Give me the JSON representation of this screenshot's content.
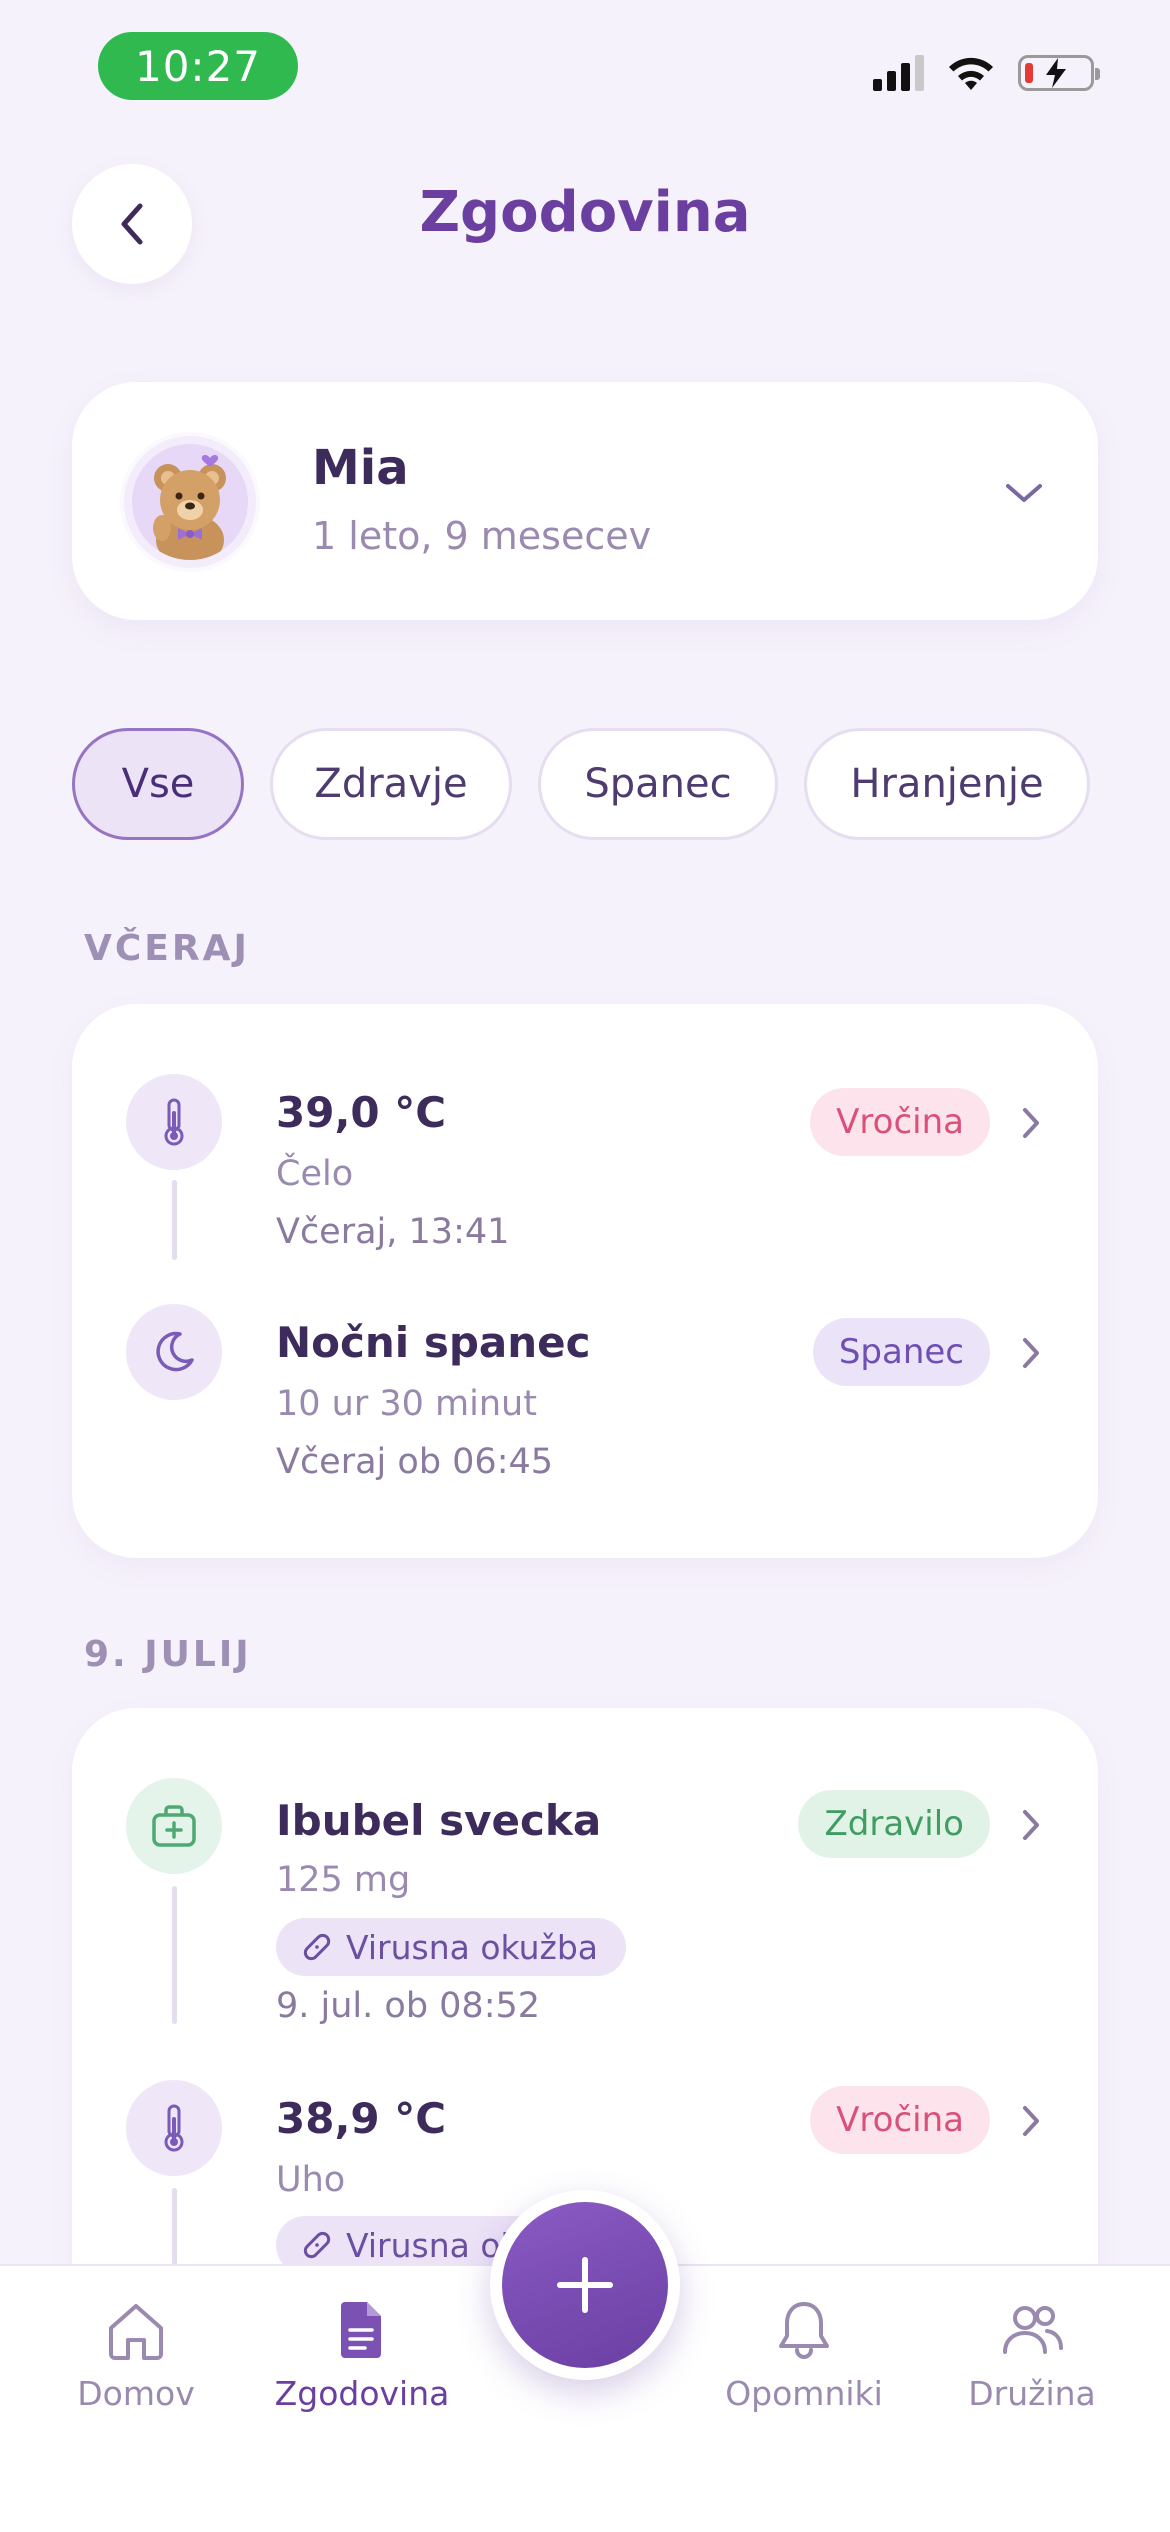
{
  "status_bar": {
    "time": "10:27",
    "battery_level": 0.1,
    "colors": {
      "time_pill": "#2fb94f",
      "battery_low": "#e53935"
    }
  },
  "header": {
    "title": "Zgodovina",
    "back_icon": "chevron-left-icon"
  },
  "child": {
    "name": "Mia",
    "age": "1 leto, 9 mesecev",
    "avatar": "teddy-bear-avatar",
    "selector_icon": "chevron-down-icon"
  },
  "filters": {
    "selected": "Vse",
    "items": [
      {
        "label": "Vse"
      },
      {
        "label": "Zdravje"
      },
      {
        "label": "Spanec"
      },
      {
        "label": "Hranjenje"
      }
    ]
  },
  "sections": [
    {
      "label": "VČERAJ",
      "entries": [
        {
          "icon": "thermometer-icon",
          "title": "39,0 °C",
          "subtitle": "Čelo",
          "time": "Včeraj, 13:41",
          "badge": "Vročina",
          "badge_color": "#d9517a"
        },
        {
          "icon": "moon-icon",
          "title": "Nočni spanec",
          "subtitle": "10 ur 30 minut",
          "time": "Včeraj ob 06:45",
          "badge": "Spanec",
          "badge_color": "#6f4fb5"
        }
      ]
    },
    {
      "label": "9. JULIJ",
      "entries": [
        {
          "icon": "medicine-kit-icon",
          "title": "Ibubel svecka",
          "subtitle": "125 mg",
          "tag": "Virusna okužba",
          "time": "9. jul. ob 08:52",
          "badge": "Zdravilo",
          "badge_color": "#3f9c62"
        },
        {
          "icon": "thermometer-icon",
          "title": "38,9 °C",
          "subtitle": "Uho",
          "tag": "Virusna okužba",
          "badge": "Vročina",
          "badge_color": "#d9517a"
        }
      ]
    }
  ],
  "nav": {
    "items": [
      {
        "label": "Domov",
        "icon": "home-icon"
      },
      {
        "label": "Zgodovina",
        "icon": "document-icon",
        "active": true
      },
      {
        "label": "Opomniki",
        "icon": "bell-icon"
      },
      {
        "label": "Družina",
        "icon": "people-icon"
      }
    ],
    "fab_icon": "plus-icon",
    "accent": "#6b3fa0"
  }
}
